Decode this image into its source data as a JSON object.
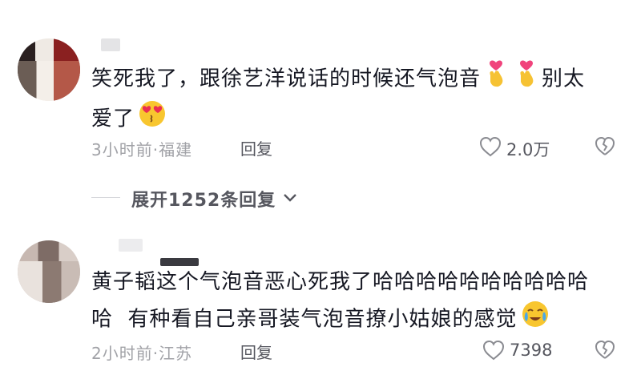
{
  "comments": [
    {
      "text_line1": "笑死我了，跟徐艺洋说话的时候还气泡音",
      "text_line1_tail": "别太",
      "text_line2": "爱了",
      "time_location": "3小时前·福建",
      "reply_label": "回复",
      "likes": "2.0万"
    },
    {
      "text_line1": "黄子韬这个气泡音恶心死我了哈哈哈哈哈哈哈哈哈哈",
      "text_line2_a": "哈",
      "text_line2_b": "有种看自己亲哥装气泡音撩小姑娘的感觉",
      "time_location": "2小时前·江苏",
      "reply_label": "回复",
      "likes": "7398"
    }
  ],
  "expand_replies": "展开1252条回复",
  "icons": {
    "like": "heart-outline-icon",
    "dislike": "broken-heart-icon",
    "emoji_love": "finger-heart-emoji",
    "emoji_kiss": "heart-eyes-kiss-emoji",
    "emoji_cry": "tearful-smile-emoji"
  },
  "colors": {
    "text": "#161823",
    "meta": "#a1a2a7",
    "action": "#56575f"
  }
}
